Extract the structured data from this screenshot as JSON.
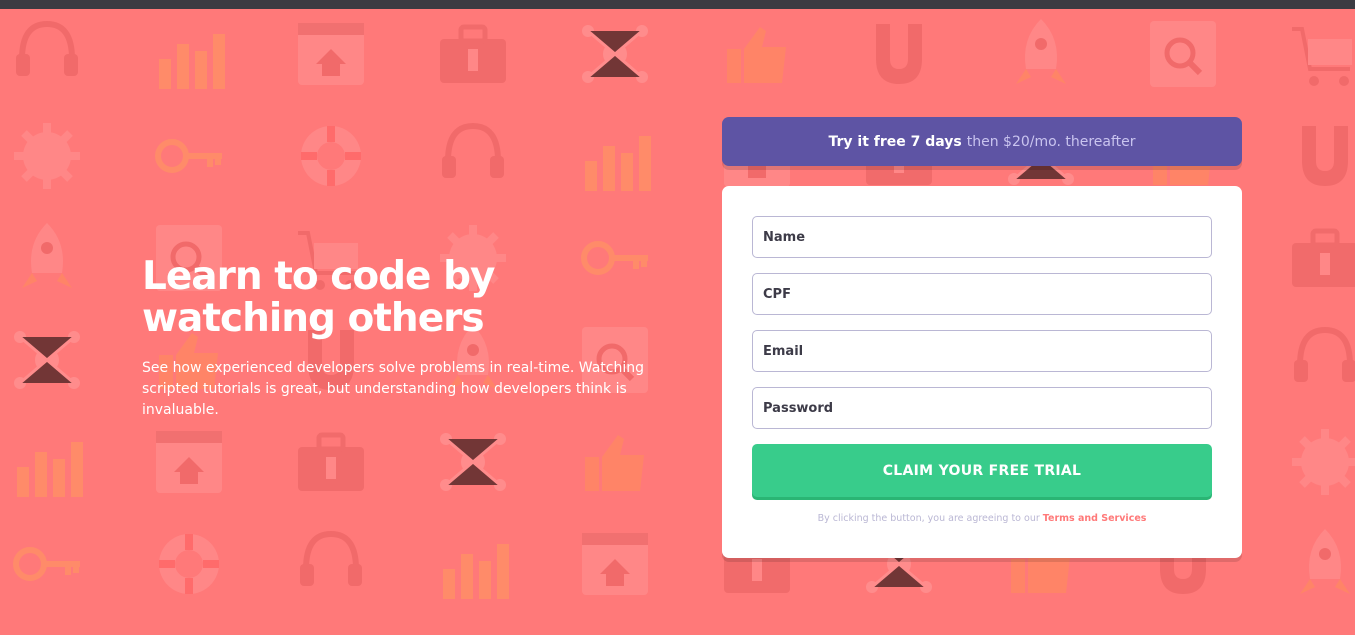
{
  "colors": {
    "background": "#ff7979",
    "promo_bg": "#5e54a4",
    "cta_bg": "#38cc8b",
    "input_border": "#bab7d4",
    "link": "#ff7979"
  },
  "hero": {
    "title_line1": "Learn to code by",
    "title_line2": "watching others",
    "body": "See how experienced developers solve problems in real-time. Watching scripted tutorials is great, but understanding how developers think is invaluable."
  },
  "promo": {
    "strong": "Try it free 7 days",
    "rest": "then $20/mo. thereafter"
  },
  "form": {
    "name_placeholder": "Name",
    "cpf_placeholder": "CPF",
    "email_placeholder": "Email",
    "password_placeholder": "Password",
    "submit_label": "CLAIM YOUR FREE TRIAL",
    "terms_text": "By clicking the button, you are agreeing to our",
    "terms_link": "Terms and Services"
  },
  "background_icons": [
    "headset-icon",
    "bar-chart-icon",
    "browser-home-icon",
    "toolbox-icon",
    "network-icon",
    "thumbs-up-icon",
    "magnet-icon",
    "rocket-icon",
    "search-window-icon",
    "shopping-cart-icon",
    "gear-icon",
    "key-icon",
    "lifebuoy-icon"
  ]
}
